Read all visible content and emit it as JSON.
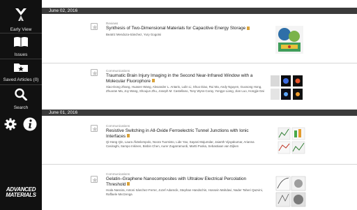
{
  "sidebar": {
    "early_view": "Early View",
    "issues": "Issues",
    "saved_articles": "Saved Articles (0)",
    "search": "Search",
    "brand_line1": "ADVANCED",
    "brand_line2": "MATERIALS"
  },
  "sections": [
    {
      "date": "June 02, 2016",
      "articles": [
        {
          "type": "Reviews",
          "title": "Synthesis of Two-Dimensional Materials for Capacitive Energy Storage",
          "authors": "Beatriz Mendoza-Sánchez, Yury Gogotsi"
        },
        {
          "type": "Communications",
          "title": "Traumatic Brain Injury Imaging in the Second Near-Infrared Window with a Molecular Fluorophore",
          "authors": "Xiao-Dong Zhang, Huasen Wang, Alexander L. Antaris, Lulin Li, Shuo Diao, Rui Ma, Andy Nguyen, Guosong Hong, Zhuoran Ma, Joy Wang, Shoujun Zhu, Joseph M. Castellano, Tony Wyss-Coray, Yongye Liang, Jian Luo, Hongjie Dai"
        }
      ]
    },
    {
      "date": "June 01, 2016",
      "articles": [
        {
          "type": "Communications",
          "title": "Resistive Switching in All-Oxide Ferroelectric Tunnel Junctions with Ionic Interfaces",
          "authors": "Qi-Hang Qin, Laura Äkäslompolo, Noora Tuomisto, Lide Yao, Sayani Majumdar, Jaianth Vijayakumar, Arianna Casiraghi, Sampo Inkinen, Binbin Chen, Aurer Zugarramurdi, Martti Puska, Sebastiaan van Dijken"
        },
        {
          "type": "Communications",
          "title": "Gelatin–Graphene Nanocomposites with Ultralow Electrical Percolation Threshold",
          "authors": "Hoda Nassira, Antoni Sánchez-Ferrer, Jozef Adamcik, Stephan Handschin, Hossein Mahdavi, Nader Taheri Qazvini, Raffaele Mezzenga"
        }
      ]
    }
  ],
  "colors": {
    "sidebar_bg": "#111111",
    "date_bar_bg": "#3b3b3b",
    "pdf_badge": "#d9a23a"
  }
}
